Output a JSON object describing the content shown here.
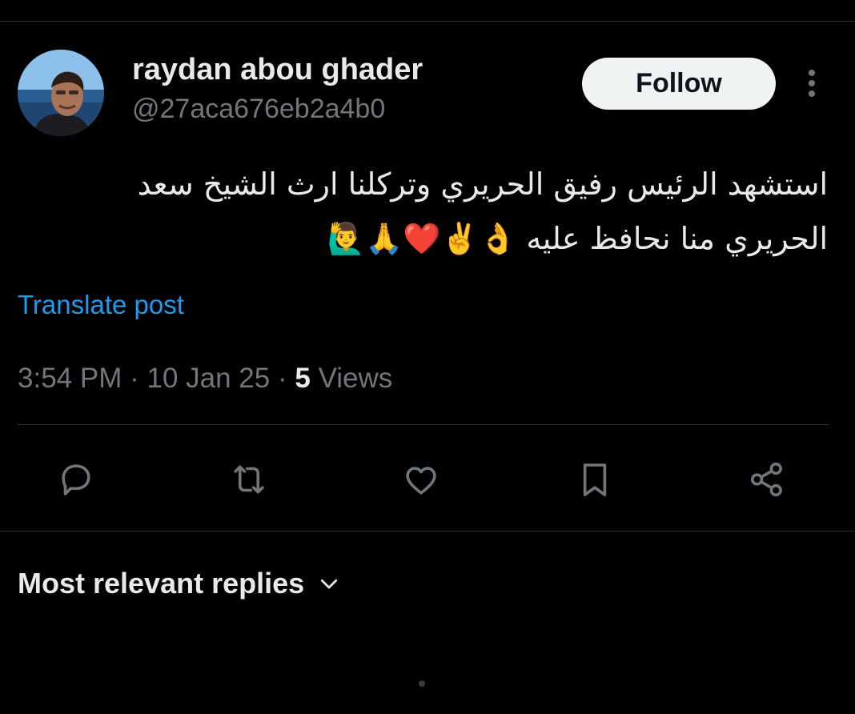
{
  "post": {
    "author": {
      "display_name": "raydan abou ghader",
      "handle": "@27aca676eb2a4b0"
    },
    "follow_label": "Follow",
    "text_lines": [
      "استشهد الرئيس رفيق الحريري وتركلنا ارث الشيخ سعد",
      "الحريري منا نحافظ عليه 👌✌️❤️🙏🙋‍♂️"
    ],
    "translate_label": "Translate post",
    "time": "3:54 PM",
    "date": "10 Jan 25",
    "separator": "·",
    "views_count": "5",
    "views_label": "Views"
  },
  "actions": [
    {
      "name": "reply-icon"
    },
    {
      "name": "repost-icon"
    },
    {
      "name": "like-icon"
    },
    {
      "name": "bookmark-icon"
    },
    {
      "name": "share-icon"
    }
  ],
  "replies": {
    "sort_label": "Most relevant replies"
  },
  "colors": {
    "background": "#000000",
    "text_primary": "#e7e9ea",
    "text_secondary": "#71767b",
    "link": "#1d9bf0",
    "divider": "#2f3336",
    "follow_bg": "#eff3f4"
  }
}
